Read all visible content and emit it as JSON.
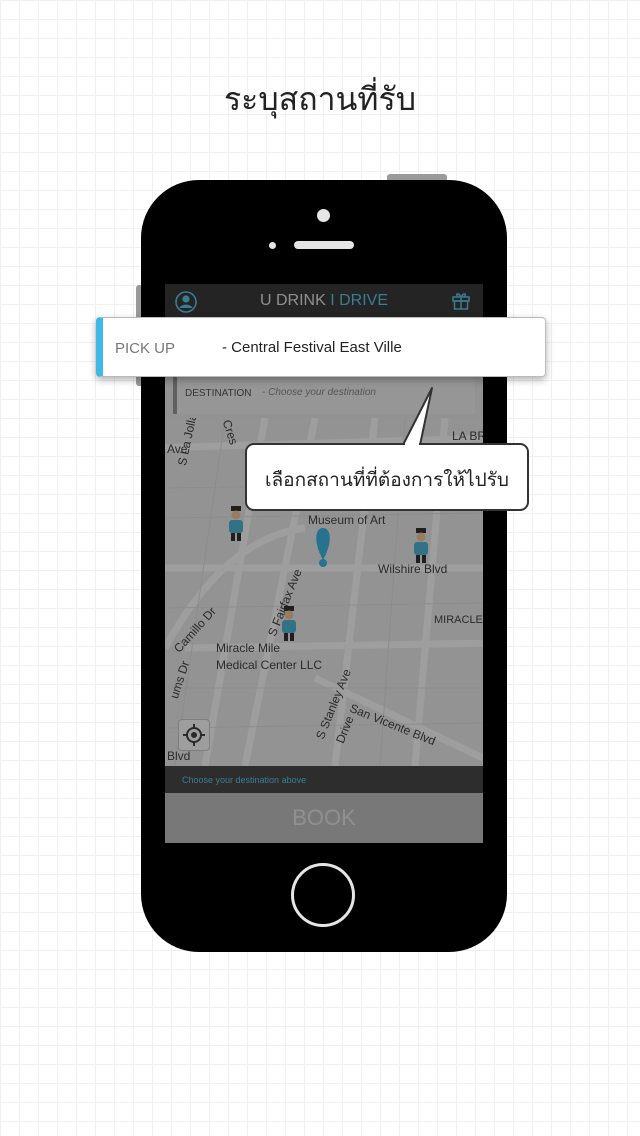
{
  "headline": "ระบุสถานที่รับ",
  "app": {
    "title_part1": "U DRINK",
    "title_separator": " I ",
    "title_part2": "DRIVE",
    "accent_color": "#5ec9ea",
    "user_icon": "user-icon",
    "gift_icon": "gift-icon"
  },
  "pickup": {
    "label": "PICK UP",
    "value": "- Central Festival East Ville",
    "accent_color": "#3fb8e6"
  },
  "destination": {
    "label": "DESTINATION",
    "value": "- Choose your destination"
  },
  "map": {
    "labels": [
      "Ave",
      "S La Jolla Ave",
      "Cres",
      "LA BR",
      "Museum of Art",
      "Wilshire Blvd",
      "S Fairfax Ave",
      "Camillo Dr",
      "MIRACLE",
      "Miracle Mile",
      "Medical Center LLC",
      "ums Dr",
      "S Stanley Ave",
      "Drive",
      "San Vicente Blvd",
      "Blvd"
    ],
    "locate_icon": "crosshair-icon"
  },
  "bottom_hint": "Choose your destination above",
  "book_label": "BOOK",
  "callout_text": "เลือกสถานที่ที่ต้องการให้ไปรับ"
}
